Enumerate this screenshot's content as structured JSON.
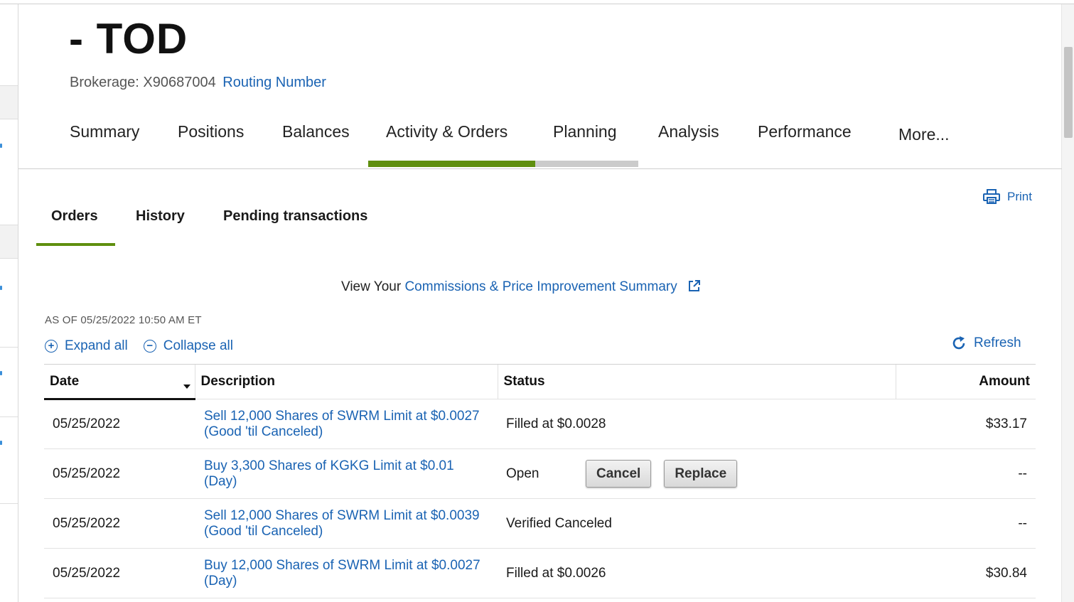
{
  "header": {
    "account_title": "- TOD",
    "brokerage_label": "Brokerage: X90687004",
    "routing_link": "Routing Number"
  },
  "main_nav": {
    "tabs": [
      {
        "label": "Summary"
      },
      {
        "label": "Positions"
      },
      {
        "label": "Balances"
      },
      {
        "label": "Activity & Orders",
        "active": true
      },
      {
        "label": "Planning"
      },
      {
        "label": "Analysis"
      },
      {
        "label": "Performance"
      },
      {
        "label": "More..."
      }
    ]
  },
  "print_label": "Print",
  "sub_tabs": [
    {
      "label": "Orders",
      "active": true
    },
    {
      "label": "History"
    },
    {
      "label": "Pending transactions"
    }
  ],
  "commissions": {
    "prefix": "View Your",
    "link": "Commissions & Price Improvement Summary"
  },
  "as_of": "AS OF 05/25/2022 10:50 AM ET",
  "controls": {
    "expand_all": "Expand all",
    "collapse_all": "Collapse all",
    "refresh": "Refresh"
  },
  "table": {
    "headers": {
      "date": "Date",
      "description": "Description",
      "status": "Status",
      "amount": "Amount"
    },
    "rows": [
      {
        "date": "05/25/2022",
        "desc_line1": "Sell 12,000 Shares of SWRM Limit at $0.0027",
        "desc_line2": "(Good 'til Canceled)",
        "status": "Filled at $0.0028",
        "amount": "$33.17"
      },
      {
        "date": "05/25/2022",
        "desc_line1": "Buy 3,300 Shares of KGKG Limit at $0.01",
        "desc_line2": "(Day)",
        "status": "Open",
        "amount": "--"
      },
      {
        "date": "05/25/2022",
        "desc_line1": "Sell 12,000 Shares of SWRM Limit at $0.0039",
        "desc_line2": "(Good 'til Canceled)",
        "status": "Verified Canceled",
        "amount": "--"
      },
      {
        "date": "05/25/2022",
        "desc_line1": "Buy 12,000 Shares of SWRM Limit at $0.0027",
        "desc_line2": "(Day)",
        "status": "Filled at $0.0026",
        "amount": "$30.84"
      }
    ],
    "cancel_label": "Cancel",
    "replace_label": "Replace"
  },
  "colors": {
    "accent_green": "#5f8f0f",
    "link_blue": "#1a63b3",
    "tab_inactive_gray": "#cbcbcb"
  }
}
